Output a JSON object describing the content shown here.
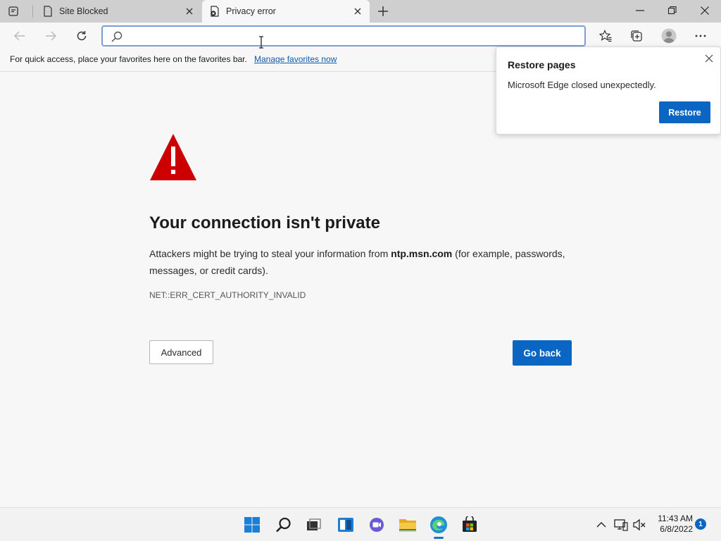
{
  "tabs": [
    {
      "title": "Site Blocked"
    },
    {
      "title": "Privacy error"
    }
  ],
  "address_bar": {
    "value": "",
    "placeholder": ""
  },
  "favorites_bar": {
    "message": "For quick access, place your favorites here on the favorites bar.",
    "link": "Manage favorites now"
  },
  "error_page": {
    "title": "Your connection isn't private",
    "desc_before": "Attackers might be trying to steal your information from ",
    "host": "ntp.msn.com",
    "desc_after": " (for example, passwords, messages, or credit cards).",
    "error_code": "NET::ERR_CERT_AUTHORITY_INVALID",
    "advanced_label": "Advanced",
    "go_back_label": "Go back"
  },
  "restore_popup": {
    "title": "Restore pages",
    "message": "Microsoft Edge closed unexpectedly.",
    "button": "Restore"
  },
  "taskbar": {
    "time": "11:43 AM",
    "date": "6/8/2022",
    "notification_count": "1"
  },
  "colors": {
    "accent": "#0a66c2",
    "warning_red": "#cc0000",
    "link": "#0b5cad"
  }
}
